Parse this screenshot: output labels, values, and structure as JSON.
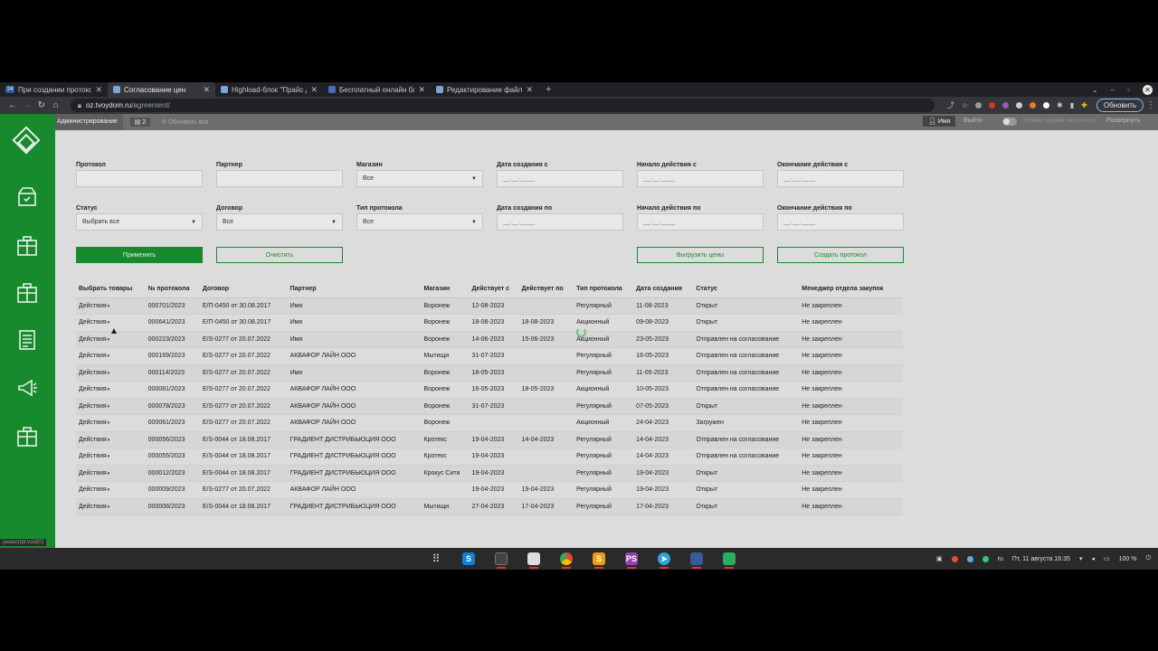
{
  "browser": {
    "tabs": [
      {
        "favicon": "24",
        "title": "При создании протокола",
        "active": false
      },
      {
        "favicon": "",
        "title": "Согласование цен",
        "active": true
      },
      {
        "favicon": "",
        "title": "Highload-блок \"Прайс д",
        "active": false
      },
      {
        "favicon": "",
        "title": "Бесплатный онлайн бло",
        "active": false
      },
      {
        "favicon": "",
        "title": "Редактирование файла",
        "active": false
      }
    ],
    "url_domain": "oz.tvoydom.ru",
    "url_path": "/agreement/",
    "update_label": "Обновить"
  },
  "topbar": {
    "admin_label": "Администрирование",
    "badge": "2",
    "refresh_label": "Обновить все",
    "user_label": "Имя",
    "logout_label": "Выйти",
    "mode_label": "Режим правки включено",
    "expand_label": "Развернуть"
  },
  "filters": {
    "protocol": {
      "label": "Протокол",
      "value": ""
    },
    "partner": {
      "label": "Партнер",
      "value": ""
    },
    "store": {
      "label": "Магазин",
      "value": "Все"
    },
    "created_from": {
      "label": "Дата создания с",
      "placeholder": "__.__.____"
    },
    "start_from": {
      "label": "Начало действия с",
      "placeholder": "__.__.____"
    },
    "end_from": {
      "label": "Окончание действия с",
      "placeholder": "__.__.____"
    },
    "status": {
      "label": "Статус",
      "value": "Выбрать все"
    },
    "contract": {
      "label": "Договор",
      "value": "Все"
    },
    "protocol_type": {
      "label": "Тип протокола",
      "value": "Все"
    },
    "created_to": {
      "label": "Дата создания по",
      "placeholder": "__.__.____"
    },
    "start_to": {
      "label": "Начало действия по",
      "placeholder": "__.__.____"
    },
    "end_to": {
      "label": "Окончание действия по",
      "placeholder": "__.__.____"
    }
  },
  "buttons": {
    "apply": "Применить",
    "clear": "Очистить",
    "export": "Выгрузить цены",
    "create": "Создать протокол"
  },
  "table": {
    "headers": [
      "Выбрать товары",
      "№ протокола",
      "Договор",
      "Партнер",
      "Магазин",
      "Действует с",
      "Действует по",
      "Тип протокола",
      "Дата создания",
      "Статус",
      "Менеджер отдела закупок"
    ],
    "rows": [
      [
        "Действия",
        "000701/2023",
        "Е/П-0450 от 30.08.2017",
        "Имя",
        "Воронеж",
        "12-08-2023",
        "",
        "Регулярный",
        "11-08-2023",
        "Открыт",
        "Не закреплен"
      ],
      [
        "Действия",
        "000641/2023",
        "Е/П-0450 от 30.08.2017",
        "Имя",
        "Воронеж",
        "18-08-2023",
        "18-08-2023",
        "Акционный",
        "09-08-2023",
        "Открыт",
        "Не закреплен"
      ],
      [
        "Действия",
        "000223/2023",
        "Е/S-0277 от 20.07.2022",
        "Имя",
        "Воронеж",
        "14-06-2023",
        "15-06-2023",
        "Акционный",
        "23-05-2023",
        "Отправлен на согласование",
        "Не закреплен"
      ],
      [
        "Действия",
        "000169/2023",
        "Е/S-0277 от 20.07.2022",
        "АКВАФОР ЛАЙН ООО",
        "Мытищи",
        "31-07-2023",
        "",
        "Регулярный",
        "16-05-2023",
        "Отправлен на согласование",
        "Не закреплен"
      ],
      [
        "Действия",
        "000114/2023",
        "Е/S-0277 от 20.07.2022",
        "Имя",
        "Воронеж",
        "18-05-2023",
        "",
        "Регулярный",
        "11-05-2023",
        "Отправлен на согласование",
        "Не закреплен"
      ],
      [
        "Действия",
        "000081/2023",
        "Е/S-0277 от 20.07.2022",
        "АКВАФОР ЛАЙН ООО",
        "Воронеж",
        "16-05-2023",
        "18-05-2023",
        "Акционный",
        "10-05-2023",
        "Отправлен на согласование",
        "Не закреплен"
      ],
      [
        "Действия",
        "000078/2023",
        "Е/S-0277 от 20.07.2022",
        "АКВАФОР ЛАЙН ООО",
        "Воронеж",
        "31-07-2023",
        "",
        "Регулярный",
        "07-05-2023",
        "Открыт",
        "Не закреплен"
      ],
      [
        "Действия",
        "000061/2023",
        "Е/S-0277 от 20.07.2022",
        "АКВАФОР ЛАЙН ООО",
        "Воронеж",
        "",
        "",
        "Акционный",
        "24-04-2023",
        "Загружен",
        "Не закреплен"
      ],
      [
        "Действия",
        "000056/2023",
        "Е/S-0044 от 18.08.2017",
        "ГРАДИЕНТ ДИСТРИБЬЮЦИЯ ООО",
        "Кротекс",
        "19-04-2023",
        "14-04-2023",
        "Регулярный",
        "14-04-2023",
        "Отправлен на согласование",
        "Не закреплен"
      ],
      [
        "Действия",
        "000055/2023",
        "Е/S-0044 от 18.08.2017",
        "ГРАДИЕНТ ДИСТРИБЬЮЦИЯ ООО",
        "Кротекс",
        "19-04-2023",
        "",
        "Регулярный",
        "14-04-2023",
        "Отправлен на согласование",
        "Не закреплен"
      ],
      [
        "Действия",
        "000012/2023",
        "Е/S-0044 от 18.08.2017",
        "ГРАДИЕНТ ДИСТРИБЬЮЦИЯ ООО",
        "Крокус Сити",
        "19-04-2023",
        "",
        "Регулярный",
        "19-04-2023",
        "Открыт",
        "Не закреплен"
      ],
      [
        "Действия",
        "000009/2023",
        "Е/S-0277 от 20.07.2022",
        "АКВАФОР ЛАЙН ООО",
        "",
        "19-04-2023",
        "19-04-2023",
        "Регулярный",
        "19-04-2023",
        "Открыт",
        "Не закреплен"
      ],
      [
        "Действия",
        "000008/2023",
        "Е/S-0044 от 18.08.2017",
        "ГРАДИЕНТ ДИСТРИБЬЮЦИЯ ООО",
        "Мытищи",
        "27-04-2023",
        "17-04-2023",
        "Регулярный",
        "17-04-2023",
        "Открыт",
        "Не закреплен"
      ]
    ]
  },
  "statusbar_url": "javascript:void(0)",
  "taskbar": {
    "lang": "ru",
    "clock": "Пт, 11 августа  16:35",
    "battery": "100 %"
  },
  "colors": {
    "brand_green": "#178a2e"
  }
}
